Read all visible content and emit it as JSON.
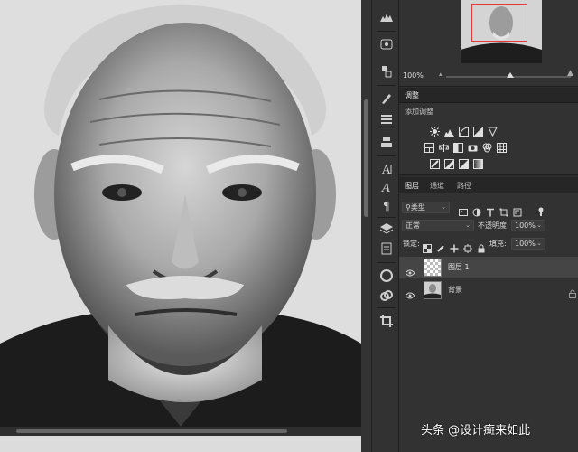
{
  "navigator": {
    "zoom": "100%"
  },
  "adjustments": {
    "tab_label": "调整",
    "add_label": "添加调整",
    "icons_row1": [
      "brightness-icon",
      "levels-icon",
      "curves-icon",
      "exposure-icon",
      "vibrance-icon"
    ],
    "icons_row2": [
      "hue-saturation-icon",
      "color-balance-icon",
      "black-white-icon",
      "photo-filter-icon",
      "channel-mixer-icon",
      "color-lookup-icon"
    ],
    "icons_row3": [
      "invert-icon",
      "posterize-icon",
      "threshold-icon",
      "gradient-map-icon"
    ]
  },
  "layers_panel": {
    "tabs": [
      "图层",
      "通道",
      "路径"
    ],
    "filter_label": "类型",
    "blend_mode": "正常",
    "opacity_label": "不透明度:",
    "opacity_value": "100%",
    "lock_label": "锁定:",
    "fill_label": "填充:",
    "fill_value": "100%",
    "layers": [
      {
        "name": "图层 1",
        "selected": true
      },
      {
        "name": "背景",
        "selected": false
      }
    ]
  },
  "watermark": "头条 @设计癍来如此",
  "colors": {
    "panel_bg": "#323232",
    "selected_row": "#454545",
    "nav_frame": "#e23a3a"
  }
}
